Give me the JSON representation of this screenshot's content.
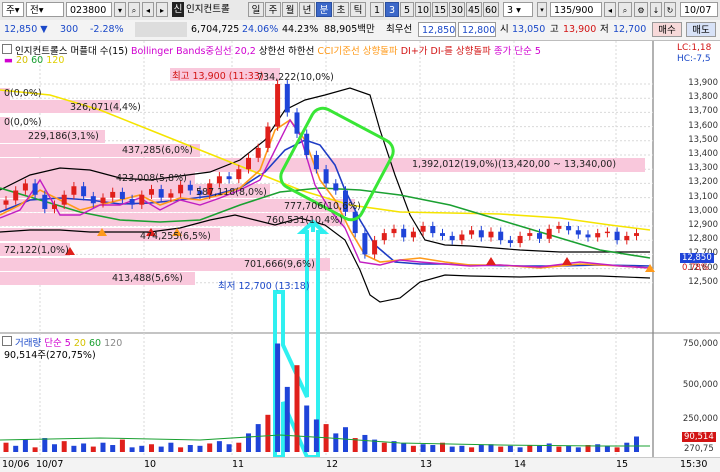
{
  "toolbar": {
    "type_label": "주",
    "type2_label": "전",
    "code_value": "023800",
    "name_badge": "신",
    "stock_name": "인지컨트롤",
    "period_buttons": [
      "일",
      "주",
      "월",
      "년",
      "분",
      "초",
      "틱"
    ],
    "interval_buttons": [
      "1",
      "3",
      "5",
      "10",
      "15",
      "30",
      "45",
      "60"
    ],
    "interval_value": "3",
    "count_value": "135/900",
    "date_value": "10/07",
    "price": "12,850",
    "change": "300",
    "change_pct": "-2.28%",
    "volume": "6,704,725",
    "vol_ratio": "24.06%",
    "turnover": "44.23%",
    "amount": "88,905백만",
    "best_label": "최우선",
    "best_ask": "12,850",
    "best_bid": "12,800",
    "open_label": "시",
    "open": "13,050",
    "high_label": "고",
    "high": "13,900",
    "low_label": "저",
    "low": "12,700",
    "buy_button": "매수",
    "sell_button": "매도"
  },
  "price_panel": {
    "legend_prefix": "인지컨트롤스 머플대 수(15)",
    "legend_bb": "Bollinger Bands중심선 20,2",
    "legend_upper": "상한선",
    "legend_lower": "하한선",
    "legend_cci": "CCI기준선 상향돌파",
    "legend_di": "DI+가 DI-를 상향돌파",
    "legend_ma": "종가 단순 5",
    "ma_periods": [
      "20",
      "60",
      "120"
    ],
    "lc_label": "LC:1,18",
    "hc_label": "HC:-7,5",
    "y_ticks": [
      "13,900",
      "13,800",
      "13,700",
      "13,600",
      "13,500",
      "13,400",
      "13,300",
      "13,200",
      "13,100",
      "13,000",
      "12,900",
      "12,800",
      "12,700",
      "12,600",
      "12,500"
    ],
    "price_tag": "12,850",
    "pct_tag": "0.78%",
    "high_note": "최고 13,900 (11:33)",
    "low_note": "최저 12,700 (13:18)",
    "volume_profile": [
      "734,222(10,0%)",
      "0(0,0%)",
      "326,071(4,4%)",
      "0(0,0%)",
      "229,186(3,1%)",
      "437,285(6,0%)",
      "1,392,012(19,0%)(13,420,00 ~ 13,340,00)",
      "423,008(5,8%)",
      "587,118(8,0%)",
      "777,706(10,6%)",
      "474,255(6,5%)",
      "760,531(10,4%)",
      "72,122(1,0%)",
      "701,666(9,6%)",
      "413,488(5,6%)"
    ]
  },
  "volume_panel": {
    "legend_title": "거래량",
    "legend_ma": "단순 5",
    "ma_periods": [
      "20",
      "60",
      "120"
    ],
    "current": "90,514주(270,75%)",
    "y_ticks": [
      "750,000",
      "500,000",
      "250,000"
    ],
    "vol_tag": "90,514",
    "zero_tag": "270,75"
  },
  "x_axis": {
    "labels": [
      "10/06",
      "10/07",
      "10",
      "11",
      "12",
      "13",
      "14",
      "15",
      "15:30"
    ]
  },
  "colors": {
    "bullish": "#e0201b",
    "bearish": "#1f44d8",
    "bb_band": "#000000",
    "ma20": "#f5e400",
    "ma60": "#1aa031",
    "ma5": "#ff9a1a",
    "annotation_green": "#39e636",
    "annotation_cyan": "#2ff0f0",
    "profile_pink": "#f9c8dc"
  },
  "chart_data": {
    "type": "candlestick",
    "timeframe": "3분",
    "price_high": 13900,
    "price_low": 12700,
    "price_range": [
      12450,
      13950
    ],
    "volume_range": [
      0,
      800000
    ],
    "x_sessions": [
      "10/06",
      "10/07"
    ],
    "x_hours": [
      "10",
      "11",
      "12",
      "13",
      "14",
      "15"
    ],
    "current_price": 12850,
    "current_volume": 90514
  }
}
